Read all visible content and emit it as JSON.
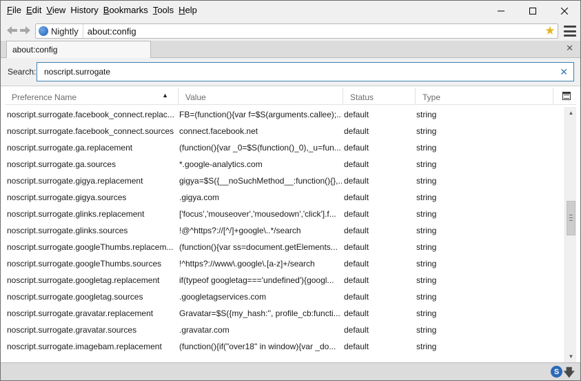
{
  "menu": {
    "items": [
      {
        "key": "F",
        "rest": "ile"
      },
      {
        "key": "E",
        "rest": "dit"
      },
      {
        "key": "V",
        "rest": "iew"
      },
      {
        "key": "",
        "rest": "History"
      },
      {
        "key": "B",
        "rest": "ookmarks"
      },
      {
        "key": "T",
        "rest": "ools"
      },
      {
        "key": "H",
        "rest": "elp"
      }
    ]
  },
  "navbar": {
    "identity_label": "Nightly",
    "url": "about:config"
  },
  "tab": {
    "title": "about:config"
  },
  "search": {
    "label": "Search:",
    "value": "noscript.surrogate"
  },
  "columns": {
    "name": "Preference Name",
    "value": "Value",
    "status": "Status",
    "type": "Type"
  },
  "rows": [
    {
      "name": "noscript.surrogate.facebook_connect.replac...",
      "value": "FB=(function(){var f=$S(arguments.callee);...",
      "status": "default",
      "type": "string"
    },
    {
      "name": "noscript.surrogate.facebook_connect.sources",
      "value": "connect.facebook.net",
      "status": "default",
      "type": "string"
    },
    {
      "name": "noscript.surrogate.ga.replacement",
      "value": "(function(){var _0=$S(function()_0),_u=fun...",
      "status": "default",
      "type": "string"
    },
    {
      "name": "noscript.surrogate.ga.sources",
      "value": "*.google-analytics.com",
      "status": "default",
      "type": "string"
    },
    {
      "name": "noscript.surrogate.gigya.replacement",
      "value": "gigya=$S({__noSuchMethod__:function(){},...",
      "status": "default",
      "type": "string"
    },
    {
      "name": "noscript.surrogate.gigya.sources",
      "value": ".gigya.com",
      "status": "default",
      "type": "string"
    },
    {
      "name": "noscript.surrogate.glinks.replacement",
      "value": "['focus','mouseover','mousedown','click'].f...",
      "status": "default",
      "type": "string"
    },
    {
      "name": "noscript.surrogate.glinks.sources",
      "value": "!@^https?://[^/]+google\\..*/search",
      "status": "default",
      "type": "string"
    },
    {
      "name": "noscript.surrogate.googleThumbs.replacem...",
      "value": "(function(){var ss=document.getElements...",
      "status": "default",
      "type": "string"
    },
    {
      "name": "noscript.surrogate.googleThumbs.sources",
      "value": "!^https?://www\\.google\\.[a-z]+/search",
      "status": "default",
      "type": "string"
    },
    {
      "name": "noscript.surrogate.googletag.replacement",
      "value": "if(typeof googletag==='undefined'){googl...",
      "status": "default",
      "type": "string"
    },
    {
      "name": "noscript.surrogate.googletag.sources",
      "value": ".googletagservices.com",
      "status": "default",
      "type": "string"
    },
    {
      "name": "noscript.surrogate.gravatar.replacement",
      "value": "Gravatar=$S({my_hash:'', profile_cb:functi...",
      "status": "default",
      "type": "string"
    },
    {
      "name": "noscript.surrogate.gravatar.sources",
      "value": ".gravatar.com",
      "status": "default",
      "type": "string"
    },
    {
      "name": "noscript.surrogate.imagebam.replacement",
      "value": "(function(){if(\"over18\" in window){var _do...",
      "status": "default",
      "type": "string"
    }
  ],
  "icons": {
    "back": "back-arrow-icon",
    "forward": "forward-arrow-icon",
    "identity": "globe-icon",
    "bookmark": "star-icon",
    "menu": "hamburger-icon",
    "clear": "clear-icon",
    "sort": "sort-ascending-icon",
    "column_picker": "column-picker-icon",
    "addon": "noscript-s-icon",
    "downloads": "download-arrow-icon"
  },
  "colors": {
    "search_border": "#3c7fb1",
    "bookmark_star": "#e6b422"
  }
}
